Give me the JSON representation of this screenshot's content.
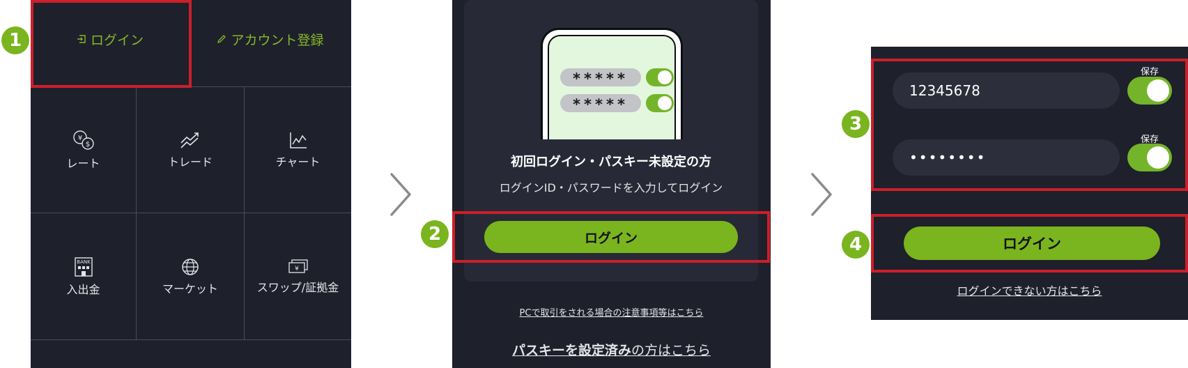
{
  "panel1": {
    "login_label": "ログイン",
    "signup_label": "アカウント登録",
    "tiles": [
      {
        "label": "レート",
        "icon": "currency-exchange-icon"
      },
      {
        "label": "トレード",
        "icon": "trend-arrows-icon"
      },
      {
        "label": "チャート",
        "icon": "line-chart-icon"
      },
      {
        "label": "入出金",
        "icon": "bank-icon"
      },
      {
        "label": "マーケット",
        "icon": "globe-icon"
      },
      {
        "label": "スワップ/証拠金",
        "icon": "yen-note-icon"
      }
    ],
    "bank_icon_text": "BANK",
    "yen_symbol": "¥"
  },
  "panel2": {
    "password_masks": [
      "*****",
      "*****"
    ],
    "heading": "初回ログイン・パスキー未設定の方",
    "subtext": "ログインID・パスワードを入力してログイン",
    "login_button": "ログイン",
    "pc_notice_link": "PCで取引をされる場合の注意事項等はこちら",
    "passkey_link_bold": "パスキーを設定済み",
    "passkey_link_rest": "の方はこちら"
  },
  "panel3": {
    "id_value": "12345678",
    "password_value": "••••••••",
    "save_label_1": "保存",
    "save_label_2": "保存",
    "login_button": "ログイン",
    "cannot_login_link": "ログインできない方はこちら"
  },
  "badges": [
    "1",
    "2",
    "3",
    "4"
  ],
  "colors": {
    "accent_green": "#7ab41e",
    "highlight_red": "#cc1f2a",
    "panel_bg": "#1e202b",
    "text_green": "#86b82a"
  }
}
